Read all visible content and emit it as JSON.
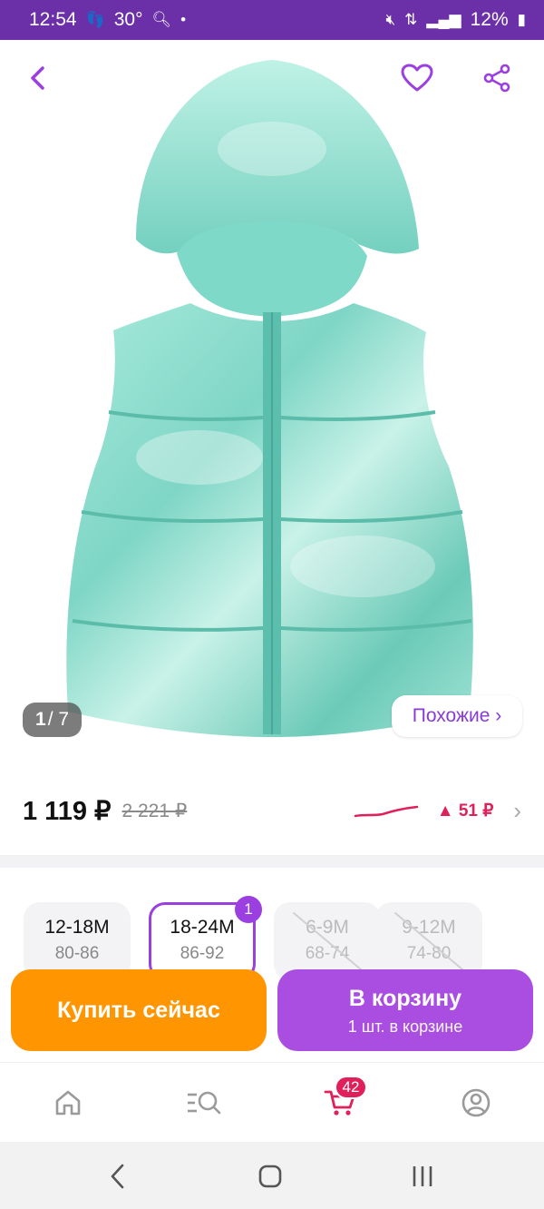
{
  "status_bar": {
    "time": "12:54",
    "temperature": "30°",
    "battery": "12%"
  },
  "product": {
    "image_counter_current": "1",
    "image_counter_total": "/ 7",
    "similar_label": "Похожие ›"
  },
  "price": {
    "current": "1 119 ₽",
    "old": "2 221 ₽",
    "diff": "▲ 51 ₽",
    "graph_color": "#e0205b"
  },
  "sizes": [
    {
      "size": "12-18M",
      "height": "80-86",
      "state": "normal"
    },
    {
      "size": "18-24M",
      "height": "86-92",
      "state": "selected",
      "badge": "1"
    },
    {
      "size": "6-9M",
      "height": "68-74",
      "state": "disabled"
    },
    {
      "size": "9-12M",
      "height": "74-80",
      "state": "disabled"
    }
  ],
  "actions": {
    "buy_now": "Купить сейчас",
    "to_cart": "В корзину",
    "in_cart": "1 шт. в корзине"
  },
  "bottom_nav": {
    "cart_badge": "42",
    "icons": [
      "home-icon",
      "catalog-search-icon",
      "cart-icon",
      "profile-icon"
    ]
  },
  "colors": {
    "accent": "#9b3fe0",
    "status_bar": "#6b2fa8",
    "buy_now": "#ff9500",
    "to_cart": "#a94ee0",
    "price_up": "#e0205b"
  }
}
